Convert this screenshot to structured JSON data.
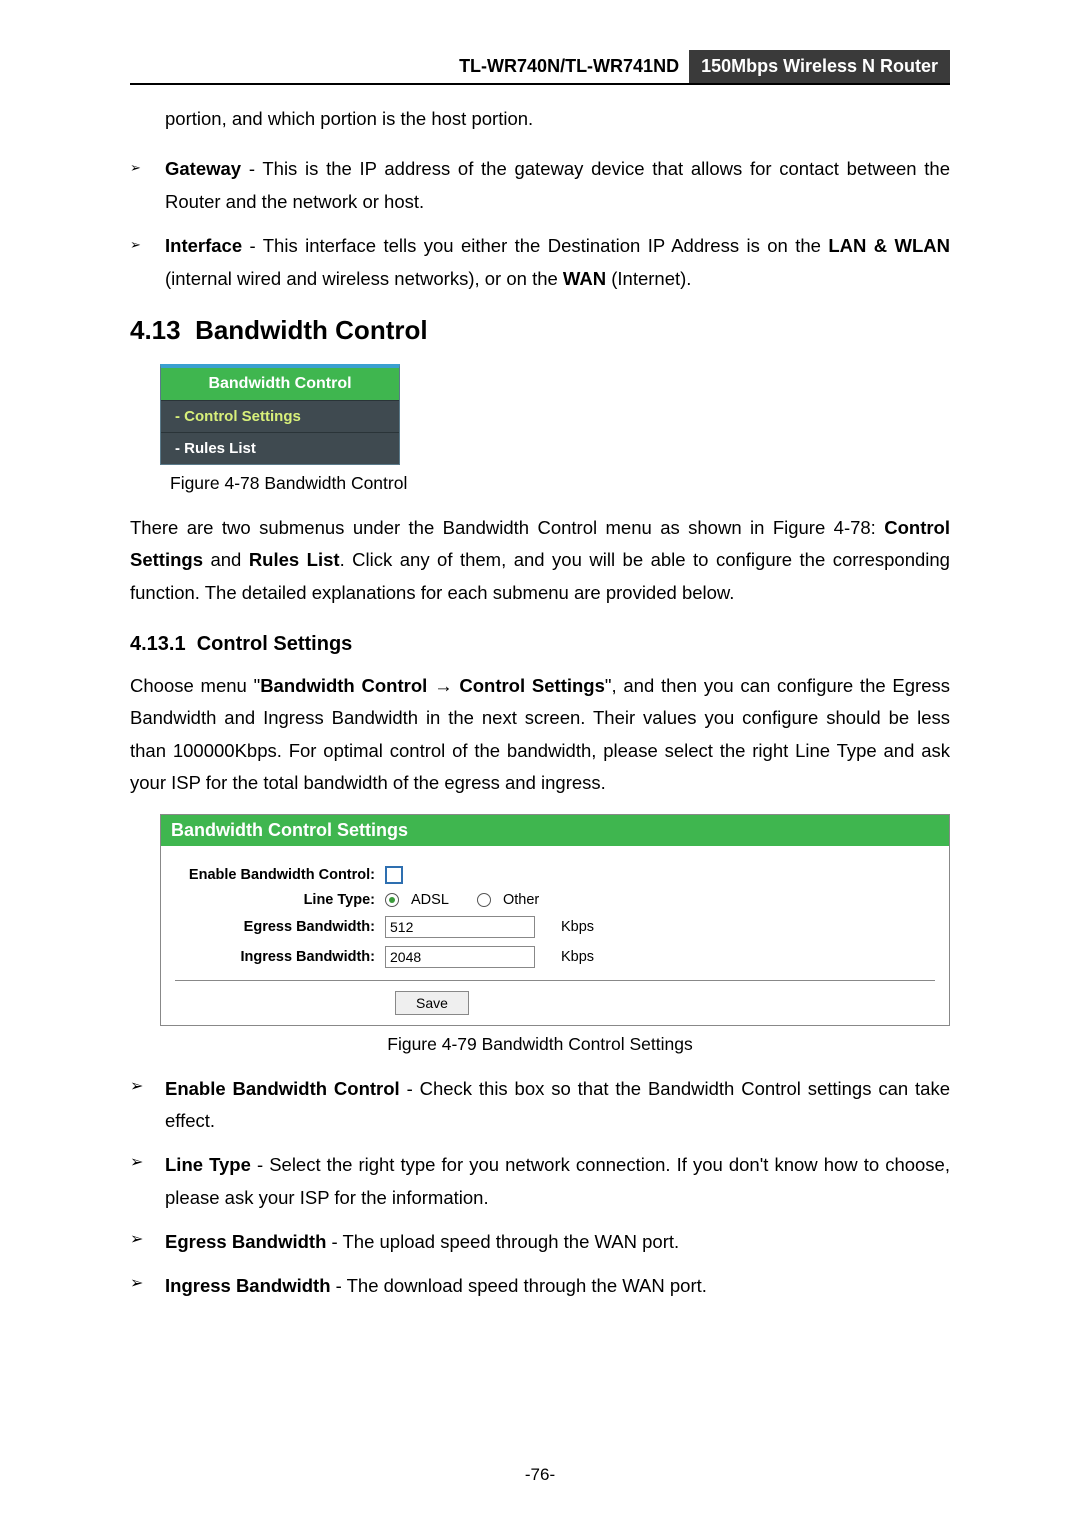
{
  "header": {
    "model": "TL-WR740N/TL-WR741ND",
    "product": "150Mbps Wireless N Router"
  },
  "intro_fragment": "portion, and which portion is the host portion.",
  "top_bullets": [
    {
      "term": "Gateway",
      "text": " - This is the IP address of the gateway device that allows for contact between the Router and the network or host."
    },
    {
      "term": "Interface",
      "text_before": " - This interface tells you either the Destination IP Address is on the ",
      "bold1": "LAN & WLAN",
      "text_mid": " (internal wired and wireless networks), or on the ",
      "bold2": "WAN",
      "text_after": " (Internet)."
    }
  ],
  "section": {
    "number": "4.13",
    "title": "Bandwidth Control"
  },
  "sidebar_figure": {
    "header": "Bandwidth Control",
    "items": [
      {
        "label": "- Control Settings",
        "active": true
      },
      {
        "label": "- Rules List",
        "active": false
      }
    ],
    "caption": "Figure 4-78 Bandwidth Control"
  },
  "section_para": {
    "before": "There are two submenus under the Bandwidth Control menu as shown in Figure 4-78: ",
    "b1": "Control Settings",
    "mid": " and ",
    "b2": "Rules List",
    "after": ". Click any of them, and you will be able to configure the corresponding function. The detailed explanations for each submenu are provided below."
  },
  "subsection": {
    "number": "4.13.1",
    "title": "Control Settings"
  },
  "subs_para": {
    "before": "Choose menu \"",
    "b1": "Bandwidth Control",
    "arrow": " → ",
    "b2": "Control Settings",
    "after": "\", and then you can configure the Egress Bandwidth and Ingress Bandwidth in the next screen. Their values you configure should be less than 100000Kbps. For optimal control of the bandwidth, please select the right Line Type and ask your ISP for the total bandwidth of the egress and ingress."
  },
  "panel": {
    "title": "Bandwidth Control Settings",
    "rows": {
      "enable_label": "Enable Bandwidth Control:",
      "line_type_label": "Line Type:",
      "line_type_opts": {
        "adsl": "ADSL",
        "other": "Other"
      },
      "egress_label": "Egress Bandwidth:",
      "egress_value": "512",
      "ingress_label": "Ingress Bandwidth:",
      "ingress_value": "2048",
      "unit": "Kbps"
    },
    "save": "Save",
    "caption": "Figure 4-79 Bandwidth Control Settings"
  },
  "bottom_bullets": [
    {
      "term": "Enable Bandwidth Control",
      "text": " - Check this box so that the Bandwidth Control settings can take effect."
    },
    {
      "term": "Line Type",
      "text": " - Select the right type for you network connection. If you don't know how to choose, please ask your ISP for the information."
    },
    {
      "term": "Egress Bandwidth",
      "text": " - The upload speed through the WAN port."
    },
    {
      "term": "Ingress Bandwidth",
      "text": " - The download speed through the WAN port."
    }
  ],
  "page_number": "-76-"
}
